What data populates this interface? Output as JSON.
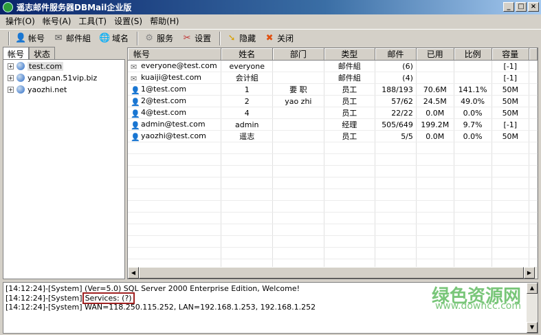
{
  "title": "遥志邮件服务器DBMail企业版",
  "window_buttons": [
    "_",
    "□",
    "×"
  ],
  "menu": [
    "操作(O)",
    "帐号(A)",
    "工具(T)",
    "设置(S)",
    "帮助(H)"
  ],
  "toolbar": [
    {
      "label": "帐号",
      "icon": "user-icon",
      "glyph": "👤"
    },
    {
      "label": "邮件組",
      "icon": "mail-group-icon",
      "glyph": "✉"
    },
    {
      "label": "域名",
      "icon": "globe-icon",
      "glyph": "🌐"
    },
    {
      "label": "服务",
      "icon": "gear-icon",
      "glyph": "⚙"
    },
    {
      "label": "设置",
      "icon": "tools-icon",
      "glyph": "✂"
    },
    {
      "label": "隐藏",
      "icon": "hide-icon",
      "glyph": "➘"
    },
    {
      "label": "关闭",
      "icon": "close-icon",
      "glyph": "✖"
    }
  ],
  "tabs": [
    "帐号",
    "状态"
  ],
  "domains": [
    "test.com",
    "yangpan.51vip.biz",
    "yaozhi.net"
  ],
  "columns": [
    "帐号",
    "姓名",
    "部门",
    "类型",
    "邮件",
    "已用",
    "比例",
    "容量"
  ],
  "rows": [
    {
      "type_icon": "group",
      "cells": [
        "everyone@test.com",
        "everyone",
        "",
        "邮件組",
        "(6)",
        "",
        "",
        "[-1]"
      ]
    },
    {
      "type_icon": "group",
      "cells": [
        "kuaiji@test.com",
        "会计組",
        "",
        "邮件組",
        "(4)",
        "",
        "",
        "[-1]"
      ]
    },
    {
      "type_icon": "user",
      "cells": [
        "1@test.com",
        "1",
        "要 职",
        "员工",
        "188/193",
        "70.6M",
        "141.1%",
        "50M"
      ]
    },
    {
      "type_icon": "user",
      "cells": [
        "2@test.com",
        "2",
        "yao zhi",
        "员工",
        "57/62",
        "24.5M",
        "49.0%",
        "50M"
      ]
    },
    {
      "type_icon": "user",
      "cells": [
        "4@test.com",
        "4",
        "",
        "员工",
        "22/22",
        "0.0M",
        "0.0%",
        "50M"
      ]
    },
    {
      "type_icon": "admin",
      "cells": [
        "admin@test.com",
        "admin",
        "",
        "经理",
        "505/649",
        "199.2M",
        "9.7%",
        "[-1]"
      ]
    },
    {
      "type_icon": "user",
      "cells": [
        "yaozhi@test.com",
        "遥志",
        "",
        "员工",
        "5/5",
        "0.0M",
        "0.0%",
        "50M"
      ]
    }
  ],
  "log": [
    {
      "prefix": "[14:12:24]-[System]",
      "text": " (Ver=5.0) SQL Server 2000 Enterprise Edition, Welcome!"
    },
    {
      "prefix": "[14:12:24]-[System]",
      "text": "Services: (?)"
    },
    {
      "prefix": "[14:12:24]-[System]",
      "text": " WAN=118.250.115.252, LAN=192.168.1.253, 192.168.1.252"
    }
  ],
  "watermark": {
    "title": "绿色资源网",
    "url": "www.downcc.com"
  }
}
